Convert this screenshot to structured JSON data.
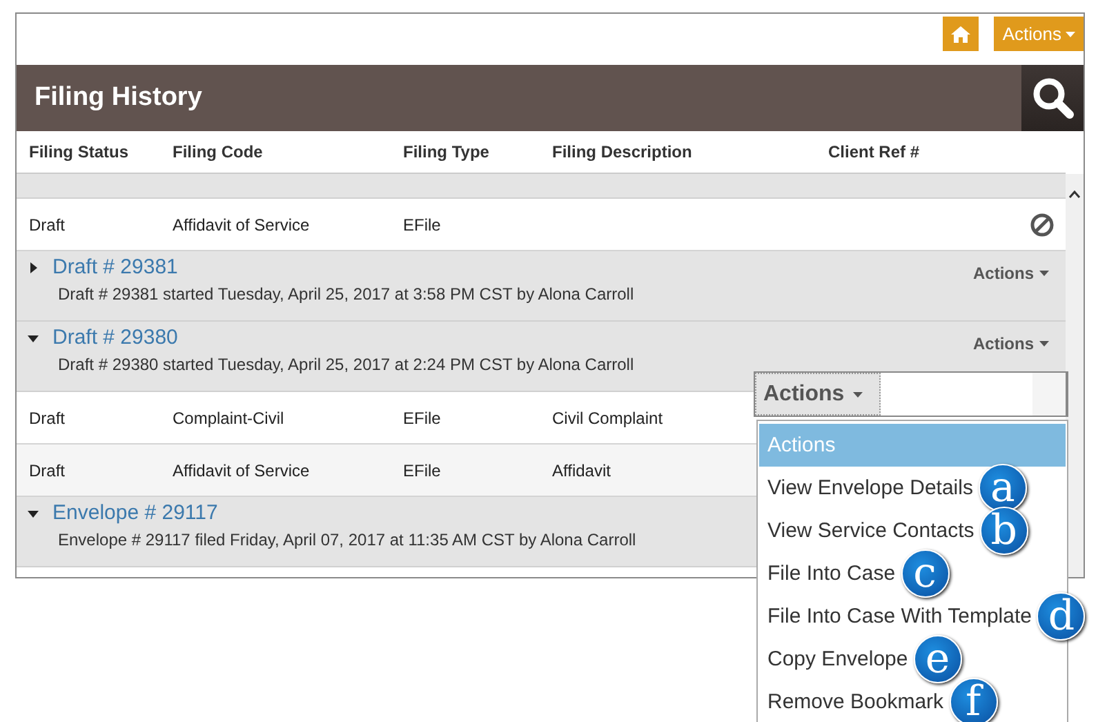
{
  "top_bar": {
    "actions_button": "Actions"
  },
  "header": {
    "title": "Filing History"
  },
  "table": {
    "columns": [
      "Filing Status",
      "Filing Code",
      "Filing Type",
      "Filing Description",
      "Client Ref #"
    ],
    "rows": [
      {
        "kind": "file",
        "cells": [
          "Draft",
          "Affidavit of Service",
          "EFile",
          ""
        ],
        "cancelable": true
      },
      {
        "kind": "group",
        "title": "Draft # 29381",
        "subtitle": "Draft # 29381 started Tuesday, April 25, 2017 at 3:58 PM CST by Alona Carroll",
        "expanded": false,
        "actions": "Actions"
      },
      {
        "kind": "group",
        "title": "Draft # 29380",
        "subtitle": "Draft # 29380 started Tuesday, April 25, 2017 at 2:24 PM CST by Alona Carroll",
        "expanded": true,
        "actions": "Actions"
      },
      {
        "kind": "file",
        "cells": [
          "Draft",
          "Complaint-Civil",
          "EFile",
          "Civil Complaint"
        ]
      },
      {
        "kind": "file",
        "cells": [
          "Draft",
          "Affidavit of Service",
          "EFile",
          "Affidavit"
        ]
      },
      {
        "kind": "group",
        "title": "Envelope # 29117",
        "subtitle": "Envelope # 29117 filed Friday, April 07, 2017 at 11:35 AM CST by Alona Carroll",
        "expanded": true
      }
    ]
  },
  "dropdown": {
    "button": "Actions",
    "items": [
      {
        "label": "Actions",
        "selected": true
      },
      {
        "label": "View Envelope Details",
        "selected": false,
        "badge": "a"
      },
      {
        "label": "View Service Contacts",
        "selected": false,
        "badge": "b"
      },
      {
        "label": "File Into Case",
        "selected": false,
        "badge": "c"
      },
      {
        "label": "File Into Case With Template",
        "selected": false,
        "badge": "d"
      },
      {
        "label": "Copy Envelope",
        "selected": false,
        "badge": "e"
      },
      {
        "label": "Remove Bookmark",
        "selected": false,
        "badge": "f"
      }
    ]
  }
}
